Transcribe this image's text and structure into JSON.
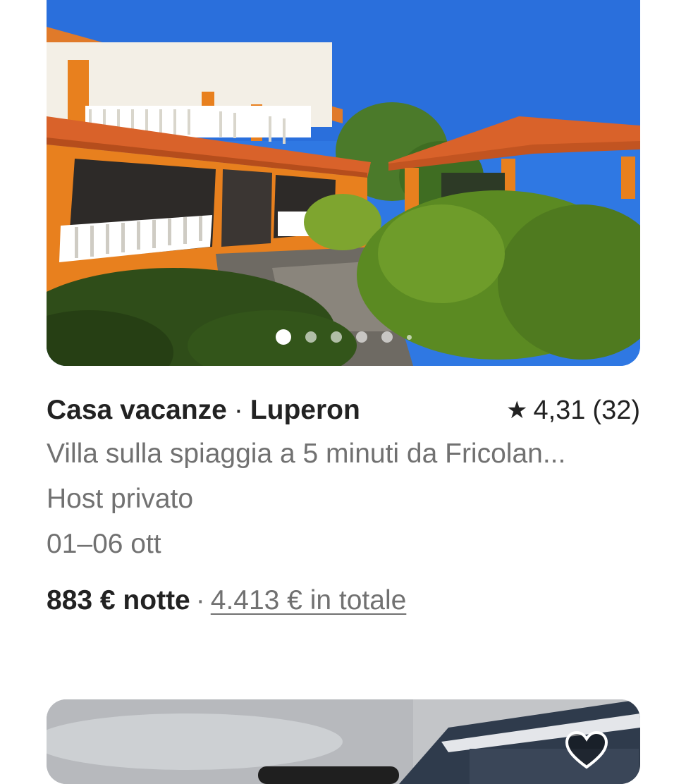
{
  "listing": {
    "photo_alt": "",
    "carousel": {
      "total_dots": 6,
      "active_index": 0
    },
    "type": "Casa vacanze",
    "separator": "·",
    "location": "Luperon",
    "rating": {
      "icon": "star-icon",
      "value": "4,31",
      "count": "(32)"
    },
    "description": "Villa sulla spiaggia a 5 minuti da Fricolan...",
    "host": "Host privato",
    "dates": "01–06 ott",
    "price": {
      "nightly": "883 € notte",
      "separator": "·",
      "total": "4.413 € in totale"
    }
  },
  "next_listing": {
    "favorite_icon": "heart-icon"
  },
  "colors": {
    "text_primary": "#222222",
    "text_secondary": "#717171",
    "sky": "#3b82e6",
    "wall_orange": "#e8801e",
    "roof": "#d9622a",
    "foliage": "#4f7a1f"
  }
}
